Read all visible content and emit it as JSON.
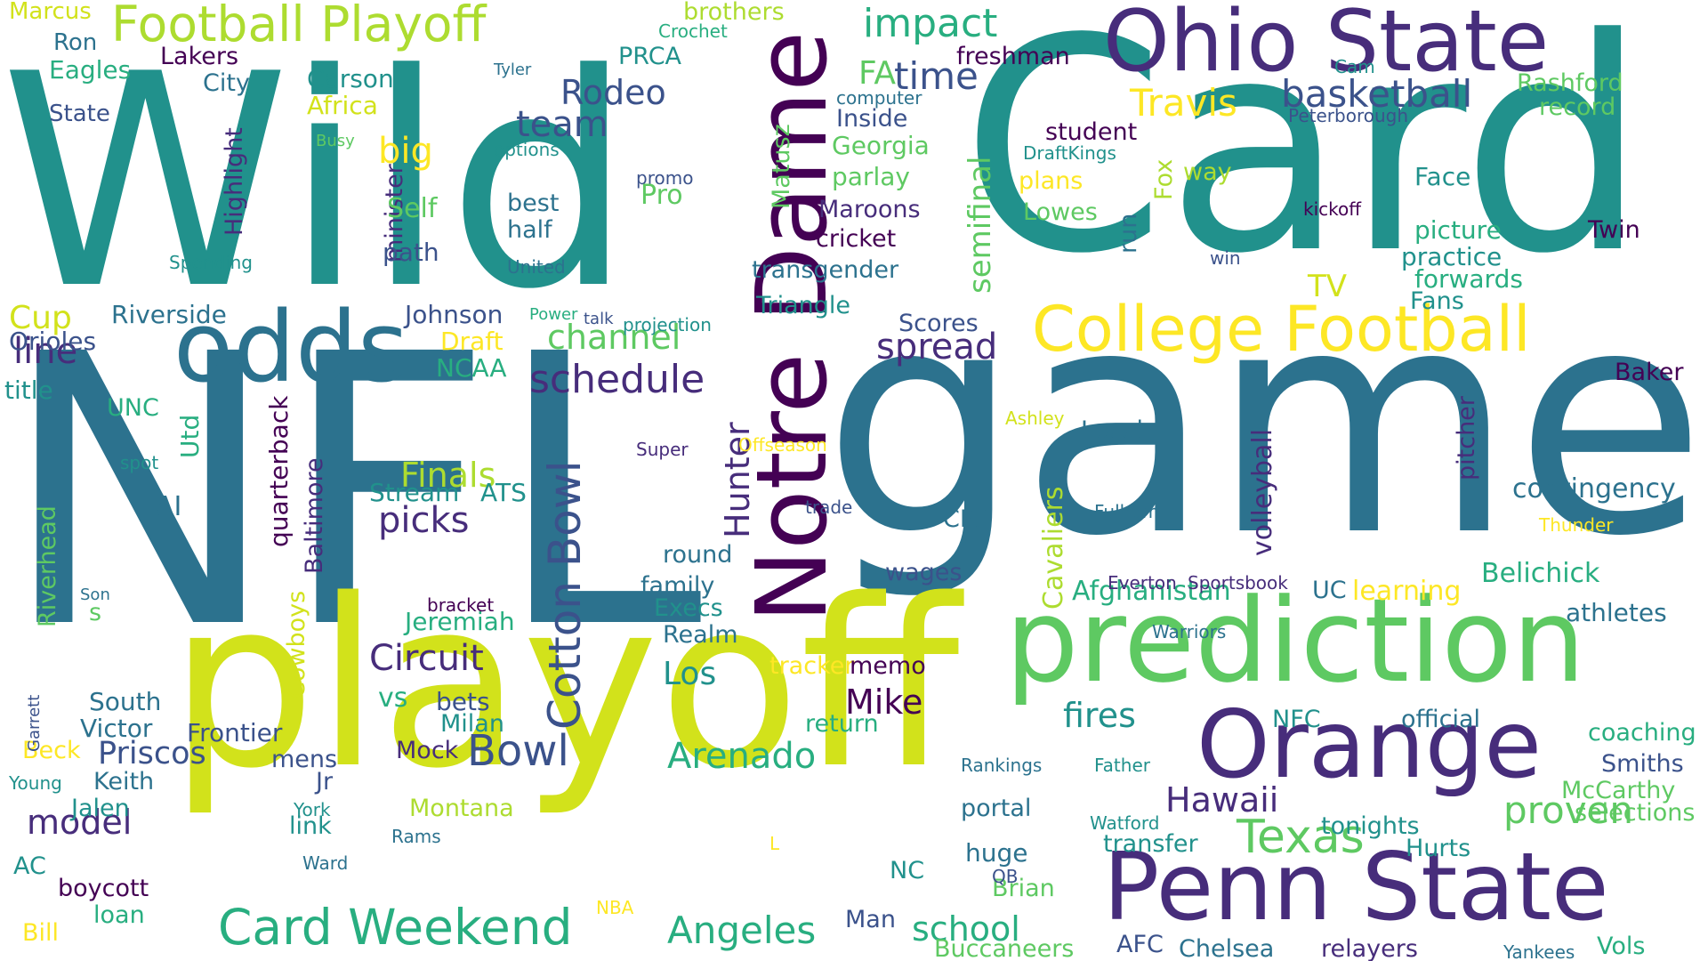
{
  "palette": {
    "dark_purple": "#440154",
    "indigo": "#472d7b",
    "blue": "#3b528b",
    "steel": "#2c728e",
    "teal": "#21918c",
    "green_teal": "#28ae80",
    "green": "#5ec962",
    "lime": "#addc30",
    "yellow_green": "#d2e21b",
    "yellow": "#fde725",
    "background": "#ffffff"
  },
  "words": [
    {
      "text": "Wild",
      "color": "#21918c"
    },
    {
      "text": "Card",
      "color": "#21918c"
    },
    {
      "text": "NFL",
      "color": "#2c728e"
    },
    {
      "text": "game",
      "color": "#2c728e"
    },
    {
      "text": "playoff",
      "color": "#d2e21b"
    },
    {
      "text": "prediction",
      "color": "#5ec962"
    },
    {
      "text": "Ohio State",
      "color": "#472d7b"
    },
    {
      "text": "Penn State",
      "color": "#472d7b"
    },
    {
      "text": "Notre Dame",
      "color": "#440154"
    },
    {
      "text": "Orange",
      "color": "#472d7b"
    },
    {
      "text": "odds",
      "color": "#2c728e"
    },
    {
      "text": "College Football",
      "color": "#fde725"
    },
    {
      "text": "Football Playoff",
      "color": "#addc30"
    },
    {
      "text": "Card Weekend",
      "color": "#28ae80"
    },
    {
      "text": "Cotton Bowl",
      "color": "#3b528b"
    },
    {
      "text": "schedule",
      "color": "#472d7b"
    },
    {
      "text": "Texas",
      "color": "#5ec962"
    },
    {
      "text": "Bowl",
      "color": "#3b528b"
    },
    {
      "text": "Angeles",
      "color": "#28ae80"
    },
    {
      "text": "Hawaii",
      "color": "#472d7b"
    },
    {
      "text": "impact",
      "color": "#28ae80"
    },
    {
      "text": "time",
      "color": "#3b528b"
    },
    {
      "text": "basketball",
      "color": "#3b528b"
    },
    {
      "text": "Travis",
      "color": "#fde725"
    },
    {
      "text": "team",
      "color": "#3b528b"
    },
    {
      "text": "Rodeo",
      "color": "#3b528b"
    },
    {
      "text": "channel",
      "color": "#5ec962"
    },
    {
      "text": "spread",
      "color": "#472d7b"
    },
    {
      "text": "picks",
      "color": "#472d7b"
    },
    {
      "text": "Circuit",
      "color": "#472d7b"
    },
    {
      "text": "Arenado",
      "color": "#28ae80"
    },
    {
      "text": "proven",
      "color": "#5ec962"
    },
    {
      "text": "fires",
      "color": "#21918c"
    },
    {
      "text": "model",
      "color": "#472d7b"
    },
    {
      "text": "Priscos",
      "color": "#3b528b"
    },
    {
      "text": "line",
      "color": "#472d7b"
    },
    {
      "text": "Finals",
      "color": "#addc30"
    },
    {
      "text": "Mike",
      "color": "#440154"
    },
    {
      "text": "Los",
      "color": "#21918c"
    },
    {
      "text": "school",
      "color": "#28ae80"
    },
    {
      "text": "Hunter",
      "color": "#472d7b"
    },
    {
      "text": "semifinal",
      "color": "#5ec962"
    },
    {
      "text": "volleyball",
      "color": "#472d7b"
    },
    {
      "text": "Cavaliers",
      "color": "#addc30"
    },
    {
      "text": "contingency",
      "color": "#2c728e"
    },
    {
      "text": "Belichick",
      "color": "#28ae80"
    },
    {
      "text": "Afghanistan",
      "color": "#28ae80"
    },
    {
      "text": "Frontier",
      "color": "#3b528b"
    },
    {
      "text": "Jeremiah",
      "color": "#28ae80"
    },
    {
      "text": "Stream",
      "color": "#21918c"
    },
    {
      "text": "ATS",
      "color": "#21918c"
    },
    {
      "text": "vs",
      "color": "#28ae80"
    },
    {
      "text": "bets",
      "color": "#3b528b"
    },
    {
      "text": "Milan",
      "color": "#21918c"
    },
    {
      "text": "Mock",
      "color": "#472d7b"
    },
    {
      "text": "mens",
      "color": "#3b528b"
    },
    {
      "text": "Keith",
      "color": "#2c728e"
    },
    {
      "text": "Jalen",
      "color": "#21918c"
    },
    {
      "text": "boycott",
      "color": "#440154"
    },
    {
      "text": "Montana",
      "color": "#addc30"
    },
    {
      "text": "link",
      "color": "#21918c"
    },
    {
      "text": "loan",
      "color": "#28ae80"
    },
    {
      "text": "Jr",
      "color": "#3b528b"
    },
    {
      "text": "Victor",
      "color": "#2c728e"
    },
    {
      "text": "South",
      "color": "#2c728e"
    },
    {
      "text": "Beck",
      "color": "#fde725"
    },
    {
      "text": "AC",
      "color": "#21918c"
    },
    {
      "text": "Bill",
      "color": "#fde725"
    },
    {
      "text": "Riverhead",
      "color": "#5ec962"
    },
    {
      "text": "Young",
      "color": "#21918c"
    },
    {
      "text": "Garrett",
      "color": "#3b528b"
    },
    {
      "text": "Son",
      "color": "#2c728e"
    },
    {
      "text": "s",
      "color": "#5ec962"
    },
    {
      "text": "spot",
      "color": "#21918c"
    },
    {
      "text": "AI",
      "color": "#2c728e"
    },
    {
      "text": "UNC",
      "color": "#28ae80"
    },
    {
      "text": "title",
      "color": "#21918c"
    },
    {
      "text": "Cup",
      "color": "#d2e21b"
    },
    {
      "text": "Orioles",
      "color": "#3b528b"
    },
    {
      "text": "Riverside",
      "color": "#2c728e"
    },
    {
      "text": "Johnson",
      "color": "#3b528b"
    },
    {
      "text": "Draft",
      "color": "#fde725"
    },
    {
      "text": "NCAA",
      "color": "#28ae80"
    },
    {
      "text": "Utd",
      "color": "#28ae80"
    },
    {
      "text": "quarterback",
      "color": "#440154"
    },
    {
      "text": "Baltimore",
      "color": "#472d7b"
    },
    {
      "text": "Cowboys",
      "color": "#d2e21b"
    },
    {
      "text": "bracket",
      "color": "#440154"
    },
    {
      "text": "York",
      "color": "#21918c"
    },
    {
      "text": "Ward",
      "color": "#2c728e"
    },
    {
      "text": "Rams",
      "color": "#2c728e"
    },
    {
      "text": "Marcus",
      "color": "#d2e21b"
    },
    {
      "text": "Ron",
      "color": "#2c728e"
    },
    {
      "text": "Eagles",
      "color": "#28ae80"
    },
    {
      "text": "State",
      "color": "#3b528b"
    },
    {
      "text": "Lakers",
      "color": "#440154"
    },
    {
      "text": "City",
      "color": "#2c728e"
    },
    {
      "text": "Carson",
      "color": "#21918c"
    },
    {
      "text": "Africa",
      "color": "#d2e21b"
    },
    {
      "text": "Highlight",
      "color": "#472d7b"
    },
    {
      "text": "Spending",
      "color": "#21918c"
    },
    {
      "text": "minister",
      "color": "#472d7b"
    },
    {
      "text": "big",
      "color": "#fde725"
    },
    {
      "text": "Self",
      "color": "#5ec962"
    },
    {
      "text": "path",
      "color": "#3b528b"
    },
    {
      "text": "Busy",
      "color": "#5ec962"
    },
    {
      "text": "Tyler",
      "color": "#2c728e"
    },
    {
      "text": "options",
      "color": "#21918c"
    },
    {
      "text": "best",
      "color": "#2c728e"
    },
    {
      "text": "half",
      "color": "#2c728e"
    },
    {
      "text": "United",
      "color": "#2c728e"
    },
    {
      "text": "Power",
      "color": "#28ae80"
    },
    {
      "text": "talk",
      "color": "#3b528b"
    },
    {
      "text": "projection",
      "color": "#21918c"
    },
    {
      "text": "Crochet",
      "color": "#28ae80"
    },
    {
      "text": "brothers",
      "color": "#addc30"
    },
    {
      "text": "PRCA",
      "color": "#21918c"
    },
    {
      "text": "Matusz",
      "color": "#5ec962"
    },
    {
      "text": "promo",
      "color": "#3b528b"
    },
    {
      "text": "Pro",
      "color": "#5ec962"
    },
    {
      "text": "FA",
      "color": "#5ec962"
    },
    {
      "text": "computer",
      "color": "#2c728e"
    },
    {
      "text": "Inside",
      "color": "#3b528b"
    },
    {
      "text": "Georgia",
      "color": "#5ec962"
    },
    {
      "text": "parlay",
      "color": "#5ec962"
    },
    {
      "text": "Maroons",
      "color": "#472d7b"
    },
    {
      "text": "cricket",
      "color": "#440154"
    },
    {
      "text": "transgender",
      "color": "#2c728e"
    },
    {
      "text": "Triangle",
      "color": "#21918c"
    },
    {
      "text": "freshman",
      "color": "#440154"
    },
    {
      "text": "Cam",
      "color": "#21918c"
    },
    {
      "text": "Peterborough",
      "color": "#3b528b"
    },
    {
      "text": "Rashford",
      "color": "#5ec962"
    },
    {
      "text": "record",
      "color": "#5ec962"
    },
    {
      "text": "student",
      "color": "#440154"
    },
    {
      "text": "DraftKings",
      "color": "#21918c"
    },
    {
      "text": "plans",
      "color": "#fde725"
    },
    {
      "text": "Lowes",
      "color": "#5ec962"
    },
    {
      "text": "run",
      "color": "#2c728e"
    },
    {
      "text": "Fox",
      "color": "#addc30"
    },
    {
      "text": "way",
      "color": "#addc30"
    },
    {
      "text": "kickoff",
      "color": "#440154"
    },
    {
      "text": "Face",
      "color": "#21918c"
    },
    {
      "text": "picture",
      "color": "#28ae80"
    },
    {
      "text": "practice",
      "color": "#21918c"
    },
    {
      "text": "forwards",
      "color": "#28ae80"
    },
    {
      "text": "Fans",
      "color": "#21918c"
    },
    {
      "text": "Twin",
      "color": "#440154"
    },
    {
      "text": "win",
      "color": "#3b528b"
    },
    {
      "text": "TV",
      "color": "#d2e21b"
    },
    {
      "text": "Scores",
      "color": "#3b528b"
    },
    {
      "text": "Baker",
      "color": "#440154"
    },
    {
      "text": "Ashley",
      "color": "#d2e21b"
    },
    {
      "text": "Local",
      "color": "#2c728e"
    },
    {
      "text": "pitcher",
      "color": "#472d7b"
    },
    {
      "text": "Fulham",
      "color": "#2c728e"
    },
    {
      "text": "Thunder",
      "color": "#fde725"
    },
    {
      "text": "CFP",
      "color": "#2c728e"
    },
    {
      "text": "wages",
      "color": "#3b528b"
    },
    {
      "text": "round",
      "color": "#2c728e"
    },
    {
      "text": "family",
      "color": "#2c728e"
    },
    {
      "text": "Execs",
      "color": "#21918c"
    },
    {
      "text": "Realm",
      "color": "#2c728e"
    },
    {
      "text": "tracker",
      "color": "#fde725"
    },
    {
      "text": "memo",
      "color": "#440154"
    },
    {
      "text": "return",
      "color": "#28ae80"
    },
    {
      "text": "Super",
      "color": "#472d7b"
    },
    {
      "text": "Offseason",
      "color": "#fde725"
    },
    {
      "text": "trade",
      "color": "#3b528b"
    },
    {
      "text": "Everton",
      "color": "#472d7b"
    },
    {
      "text": "Sportsbook",
      "color": "#472d7b"
    },
    {
      "text": "Warriors",
      "color": "#2c728e"
    },
    {
      "text": "UC",
      "color": "#2c728e"
    },
    {
      "text": "learning",
      "color": "#fde725"
    },
    {
      "text": "athletes",
      "color": "#2c728e"
    },
    {
      "text": "official",
      "color": "#2c728e"
    },
    {
      "text": "NFC",
      "color": "#21918c"
    },
    {
      "text": "coaching",
      "color": "#28ae80"
    },
    {
      "text": "Smiths",
      "color": "#3b528b"
    },
    {
      "text": "McCarthy",
      "color": "#5ec962"
    },
    {
      "text": "selections",
      "color": "#5ec962"
    },
    {
      "text": "Rankings",
      "color": "#2c728e"
    },
    {
      "text": "Father",
      "color": "#21918c"
    },
    {
      "text": "portal",
      "color": "#2c728e"
    },
    {
      "text": "Watford",
      "color": "#21918c"
    },
    {
      "text": "tonights",
      "color": "#21918c"
    },
    {
      "text": "transfer",
      "color": "#21918c"
    },
    {
      "text": "Hurts",
      "color": "#21918c"
    },
    {
      "text": "L",
      "color": "#fde725"
    },
    {
      "text": "huge",
      "color": "#2c728e"
    },
    {
      "text": "Brian",
      "color": "#5ec962"
    },
    {
      "text": "QB",
      "color": "#3b528b"
    },
    {
      "text": "NC",
      "color": "#21918c"
    },
    {
      "text": "NBA",
      "color": "#fde725"
    },
    {
      "text": "Man",
      "color": "#3b528b"
    },
    {
      "text": "Buccaneers",
      "color": "#5ec962"
    },
    {
      "text": "AFC",
      "color": "#3b528b"
    },
    {
      "text": "Chelsea",
      "color": "#2c728e"
    },
    {
      "text": "relayers",
      "color": "#472d7b"
    },
    {
      "text": "Yankees",
      "color": "#2c728e"
    },
    {
      "text": "Vols",
      "color": "#28ae80"
    }
  ]
}
